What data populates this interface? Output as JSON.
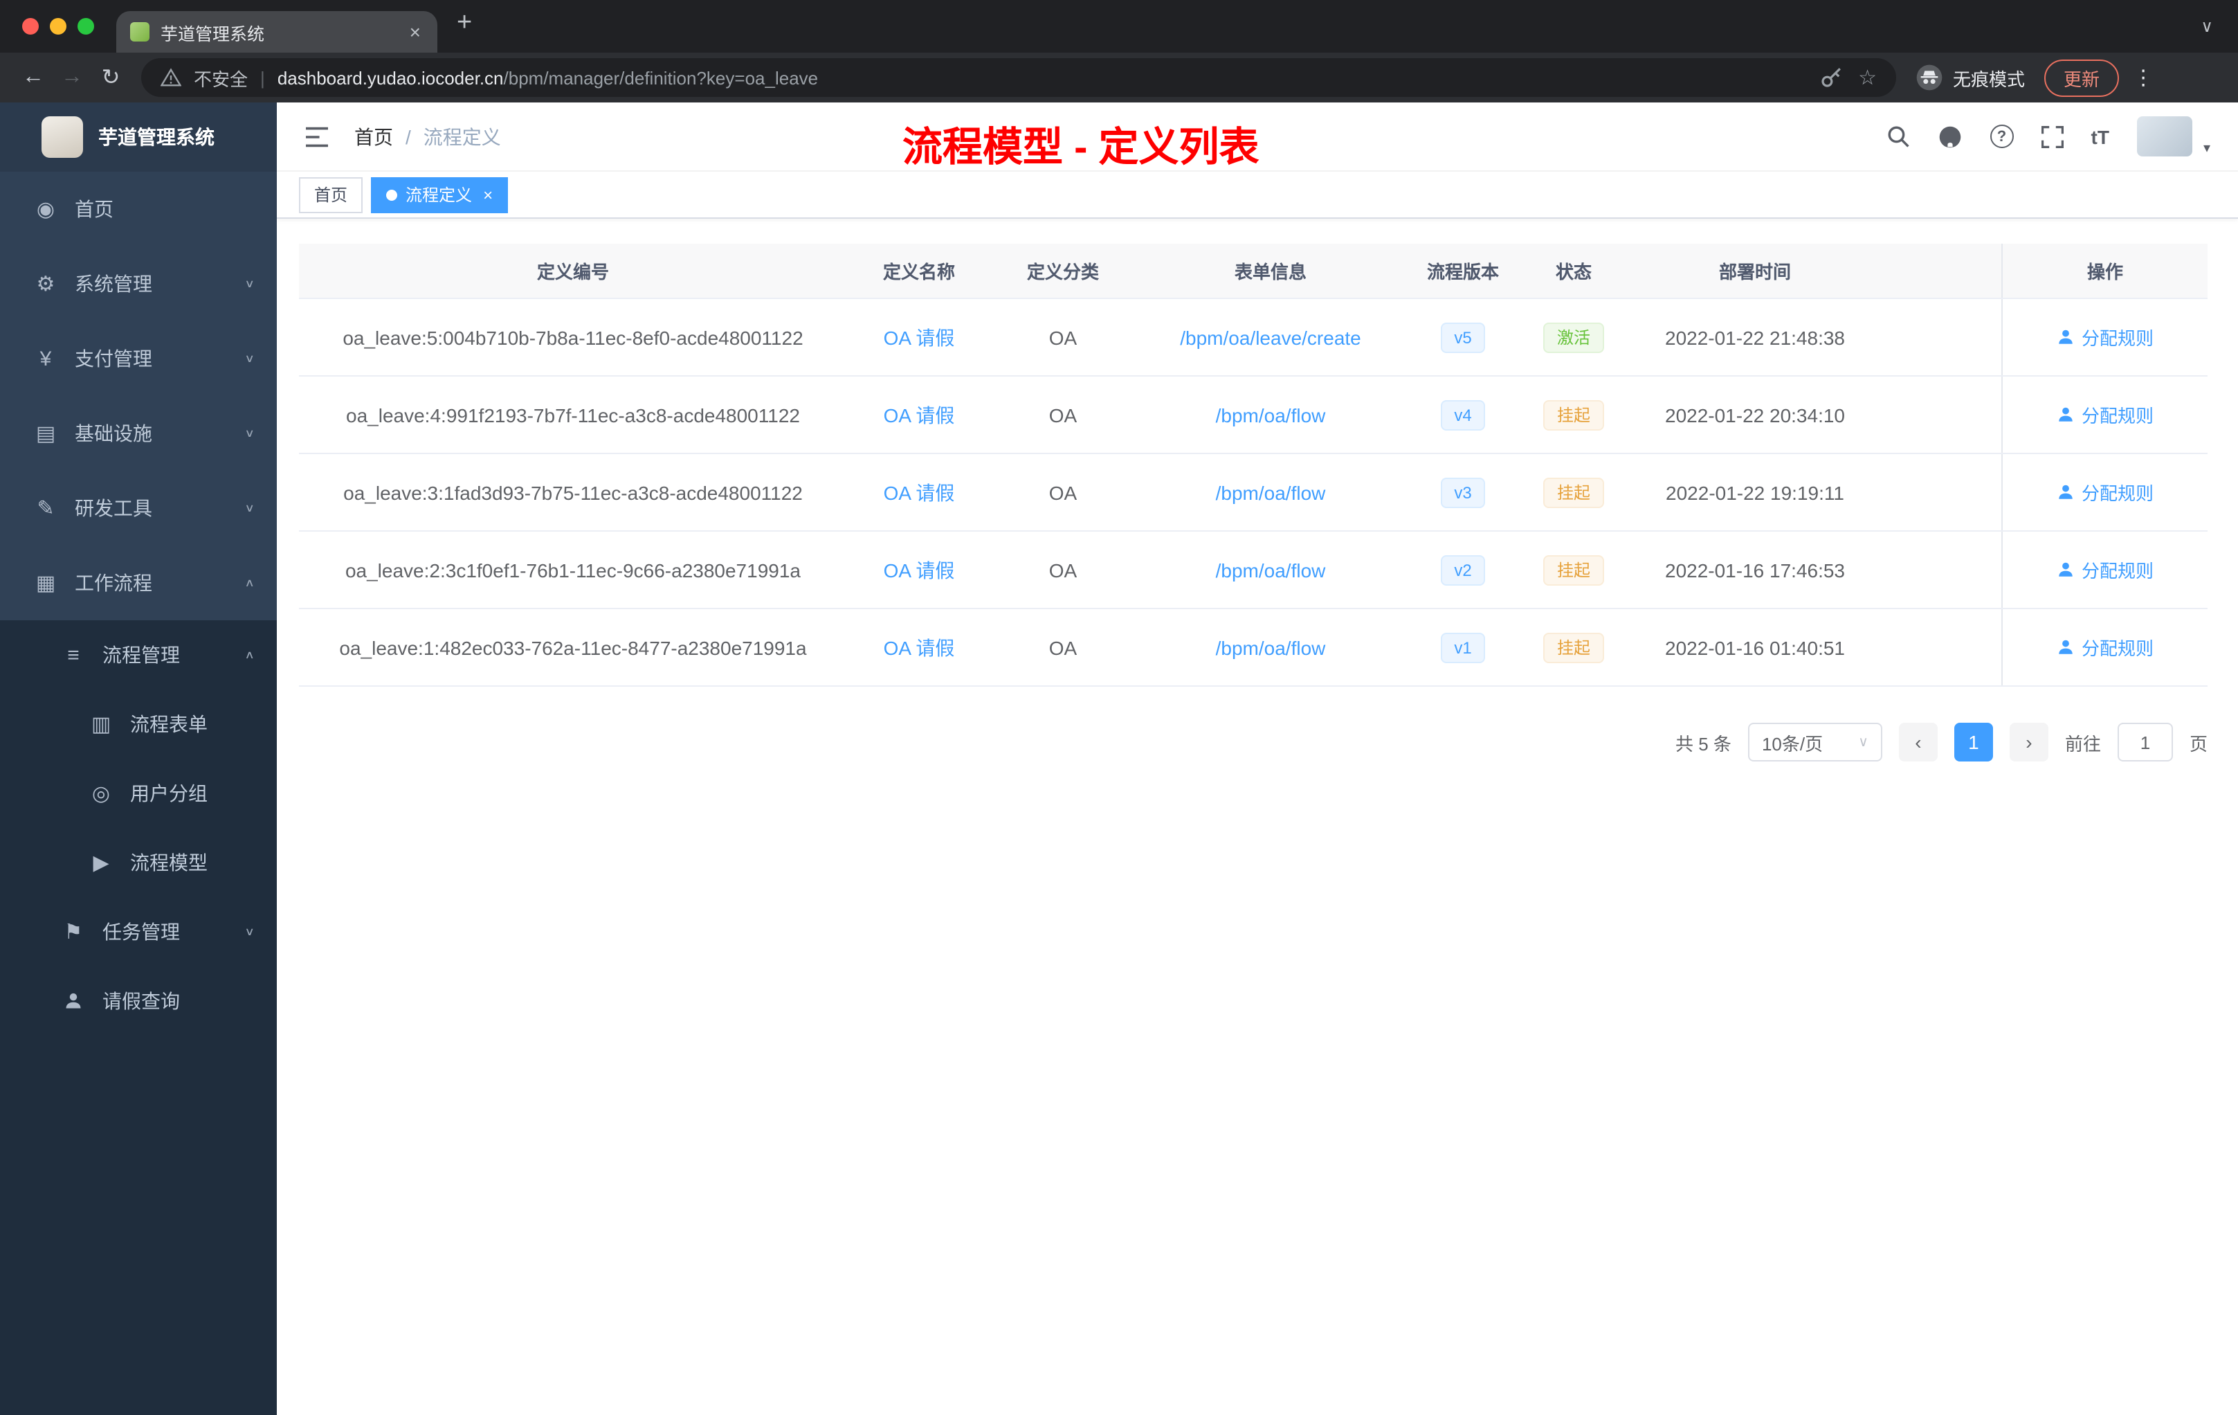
{
  "browser": {
    "tab_title": "芋道管理系统",
    "security_label": "不安全",
    "url_host": "dashboard.yudao.iocoder.cn",
    "url_path": "/bpm/manager/definition?key=oa_leave",
    "incognito_label": "无痕模式",
    "update_label": "更新"
  },
  "icons": {
    "close": "×",
    "plus": "+",
    "chevron_down": "∨",
    "chevron_up": "∧",
    "caret_down": "▾",
    "back": "←",
    "forward": "→",
    "reload": "↻",
    "star": "☆",
    "kebab": "⋮",
    "divider": "|",
    "breadcrumb_sep": "/",
    "prev": "‹",
    "next": "›",
    "question": "?",
    "font_size": "tT",
    "menu_home": "◉",
    "menu_system": "⚙",
    "menu_pay": "¥",
    "menu_infra": "▤",
    "menu_dev": "✎",
    "menu_flow": "▦",
    "menu_process": "≡",
    "menu_form": "▥",
    "menu_group": "◎",
    "menu_model": "▶",
    "menu_task": "⚑"
  },
  "sidebar": {
    "logo_title": "芋道管理系统",
    "items": [
      {
        "label": "首页"
      },
      {
        "label": "系统管理"
      },
      {
        "label": "支付管理"
      },
      {
        "label": "基础设施"
      },
      {
        "label": "研发工具"
      },
      {
        "label": "工作流程"
      },
      {
        "label": "流程管理"
      },
      {
        "label": "流程表单"
      },
      {
        "label": "用户分组"
      },
      {
        "label": "流程模型"
      },
      {
        "label": "任务管理"
      },
      {
        "label": "请假查询"
      }
    ]
  },
  "header": {
    "breadcrumb_home": "首页",
    "breadcrumb_current": "流程定义",
    "annotation": "流程模型 - 定义列表"
  },
  "tags": {
    "home": "首页",
    "current": "流程定义"
  },
  "table": {
    "columns": [
      "定义编号",
      "定义名称",
      "定义分类",
      "表单信息",
      "流程版本",
      "状态",
      "部署时间",
      "操作"
    ],
    "rows": [
      {
        "id": "oa_leave:5:004b710b-7b8a-11ec-8ef0-acde48001122",
        "name": "OA 请假",
        "category": "OA",
        "form": "/bpm/oa/leave/create",
        "version": "v5",
        "status": "激活",
        "time": "2022-01-22 21:48:38",
        "action": "分配规则"
      },
      {
        "id": "oa_leave:4:991f2193-7b7f-11ec-a3c8-acde48001122",
        "name": "OA 请假",
        "category": "OA",
        "form": "/bpm/oa/flow",
        "version": "v4",
        "status": "挂起",
        "time": "2022-01-22 20:34:10",
        "action": "分配规则"
      },
      {
        "id": "oa_leave:3:1fad3d93-7b75-11ec-a3c8-acde48001122",
        "name": "OA 请假",
        "category": "OA",
        "form": "/bpm/oa/flow",
        "version": "v3",
        "status": "挂起",
        "time": "2022-01-22 19:19:11",
        "action": "分配规则"
      },
      {
        "id": "oa_leave:2:3c1f0ef1-76b1-11ec-9c66-a2380e71991a",
        "name": "OA 请假",
        "category": "OA",
        "form": "/bpm/oa/flow",
        "version": "v2",
        "status": "挂起",
        "time": "2022-01-16 17:46:53",
        "action": "分配规则"
      },
      {
        "id": "oa_leave:1:482ec033-762a-11ec-8477-a2380e71991a",
        "name": "OA 请假",
        "category": "OA",
        "form": "/bpm/oa/flow",
        "version": "v1",
        "status": "挂起",
        "time": "2022-01-16 01:40:51",
        "action": "分配规则"
      }
    ]
  },
  "pagination": {
    "total": "共 5 条",
    "page_size": "10条/页",
    "current_page": "1",
    "goto_label": "前往",
    "goto_value": "1",
    "page_unit": "页"
  }
}
